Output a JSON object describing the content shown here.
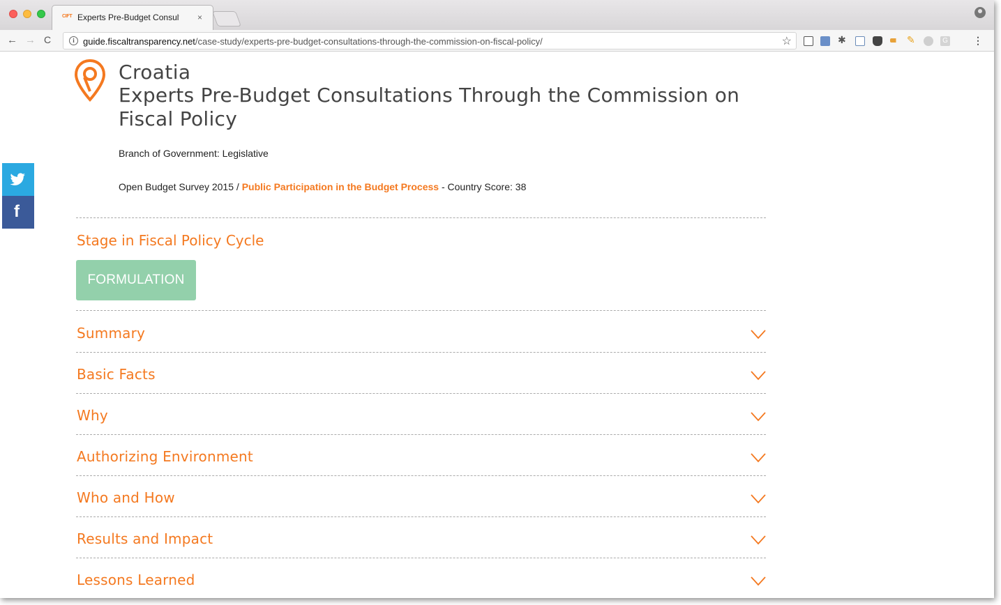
{
  "browser": {
    "tab": {
      "favicon_text": "CIFT",
      "title": "Experts Pre-Budget Consultati",
      "close": "×"
    },
    "url": {
      "host": "guide.fiscaltransparency.net",
      "path": "/case-study/experts-pre-budget-consultations-through-the-commission-on-fiscal-policy/"
    },
    "nav": {
      "back": "←",
      "forward": "→",
      "reload": "C"
    },
    "star": "☆",
    "menu": "⋮",
    "extensions": [
      "cast-icon",
      "screenshot-icon",
      "puzzle-icon",
      "crop-icon",
      "evernote-icon",
      "hammer-icon",
      "pencil-icon",
      "cloud-icon",
      "grammarly-icon"
    ]
  },
  "page": {
    "country": "Croatia",
    "title": "Experts Pre-Budget Consultations Through the Commission on Fiscal Policy",
    "branch": "Branch of Government: Legislative",
    "obs_prefix": "Open Budget Survey 2015 / ",
    "obs_link": "Public Participation in the Budget Process",
    "obs_suffix": " - Country Score: 38",
    "stage_heading": "Stage in Fiscal Policy Cycle",
    "stage_badge": "FORMULATION",
    "sections": [
      {
        "label": "Summary"
      },
      {
        "label": "Basic Facts"
      },
      {
        "label": "Why"
      },
      {
        "label": "Authorizing Environment"
      },
      {
        "label": "Who and How"
      },
      {
        "label": "Results and Impact"
      },
      {
        "label": "Lessons Learned"
      }
    ]
  },
  "colors": {
    "accent": "#f47920",
    "stage_badge": "#93d0ab",
    "twitter": "#2ba9e1",
    "facebook": "#3b5a99"
  }
}
